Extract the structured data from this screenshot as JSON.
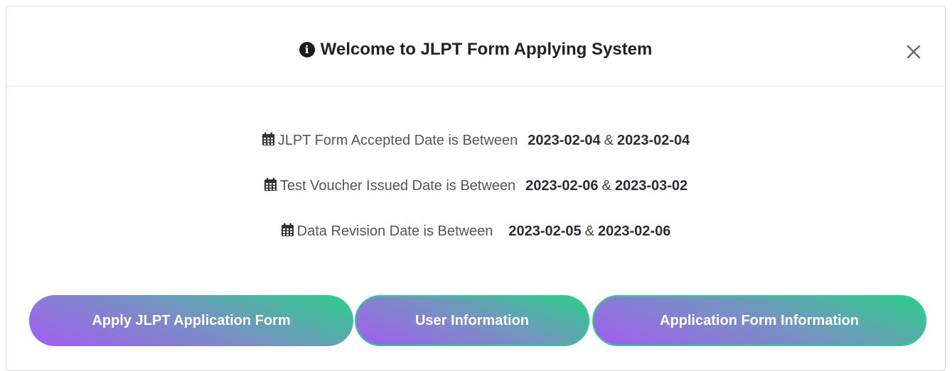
{
  "modal": {
    "title": "Welcome to JLPT Form Applying System",
    "info_icon": "info-circle-icon",
    "close_icon": "close-icon",
    "close_glyph": "×"
  },
  "dates": [
    {
      "icon": "calendar-icon",
      "label": "JLPT Form Accepted Date is Between",
      "start": "2023-02-04",
      "separator": "&",
      "end": "2023-02-04"
    },
    {
      "icon": "calendar-icon",
      "label": "Test Voucher Issued Date is Between",
      "start": "2023-02-06",
      "separator": "&",
      "end": "2023-03-02"
    },
    {
      "icon": "calendar-icon",
      "label": "Data Revision Date is Between",
      "start": "2023-02-05",
      "separator": "&",
      "end": "2023-02-06"
    }
  ],
  "buttons": {
    "apply": "Apply JLPT Application Form",
    "user_info": "User Information",
    "app_info": "Application Form Information"
  },
  "colors": {
    "gradient_start": "#a35cf0",
    "gradient_mid": "#7890c4",
    "gradient_end": "#2dcf8a"
  }
}
